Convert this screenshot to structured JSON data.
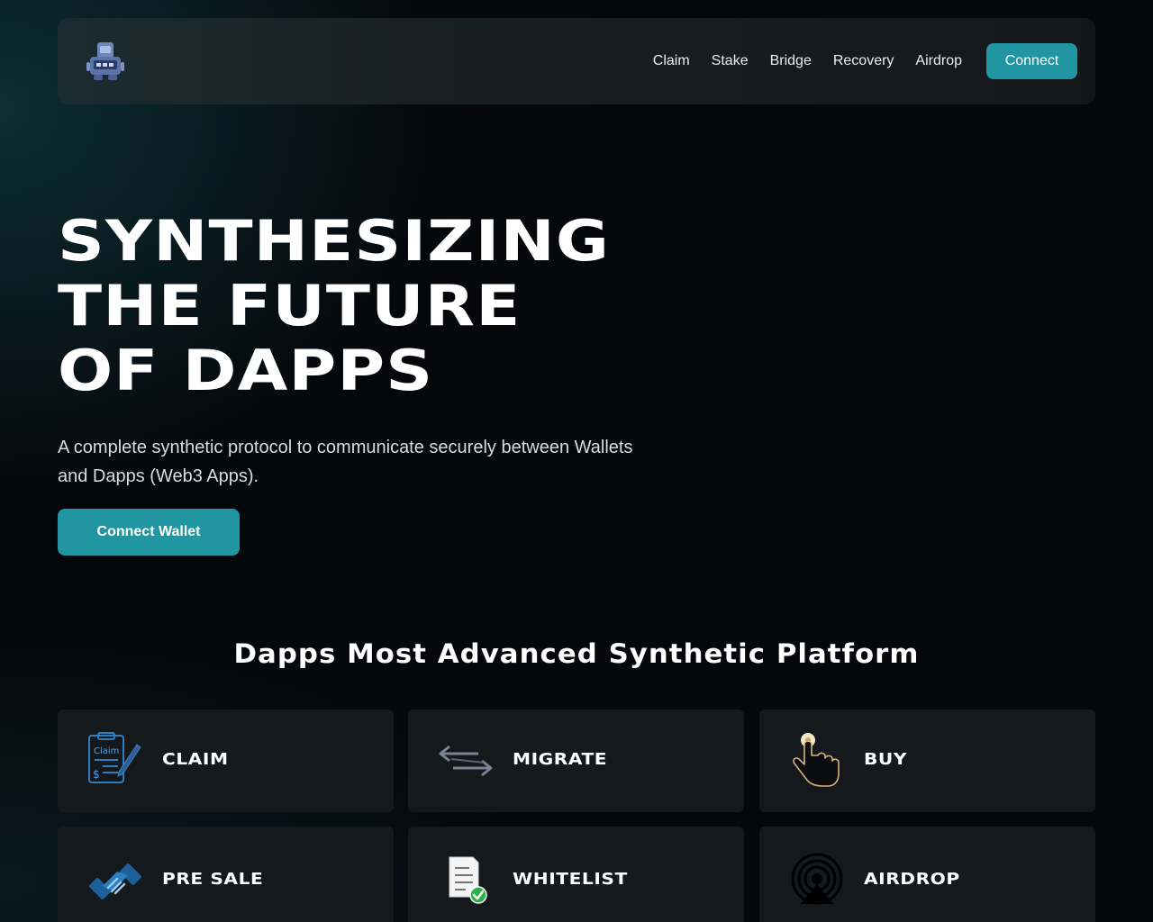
{
  "header": {
    "nav": [
      "Claim",
      "Stake",
      "Bridge",
      "Recovery",
      "Airdrop"
    ],
    "connect_label": "Connect"
  },
  "hero": {
    "title_lines": [
      "SYNTHESIZING",
      "THE FUTURE",
      "OF DAPPS"
    ],
    "subtitle": "A complete synthetic protocol to communicate securely between Wallets and Dapps (Web3 Apps).",
    "cta_label": "Connect Wallet"
  },
  "features": {
    "title": "Dapps Most Advanced Synthetic Platform",
    "cards": [
      {
        "label": "CLAIM",
        "icon": "claim-clipboard-icon"
      },
      {
        "label": "MIGRATE",
        "icon": "migrate-arrows-icon"
      },
      {
        "label": "BUY",
        "icon": "pointing-hand-icon"
      },
      {
        "label": "PRE SALE",
        "icon": "handshake-icon"
      },
      {
        "label": "WHITELIST",
        "icon": "document-check-icon"
      },
      {
        "label": "AIRDROP",
        "icon": "airdrop-signal-icon"
      }
    ],
    "claim_icon_text": [
      "Claim",
      "$"
    ]
  },
  "colors": {
    "accent": "#2196a2",
    "background": "#05070b",
    "card": "#15191c",
    "navbar": "#1f2a2d"
  }
}
